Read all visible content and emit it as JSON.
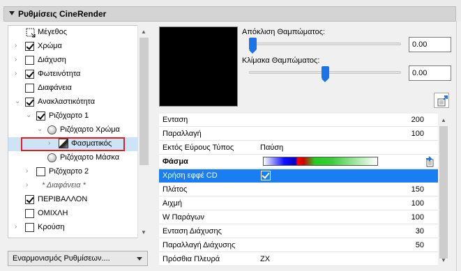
{
  "panel": {
    "title": "Ρυθμίσεις CineRender"
  },
  "tree": {
    "items": [
      {
        "label": "Μέγεθος",
        "indent": 0,
        "expander": false,
        "control": "size-icon",
        "checked": false,
        "italic": false
      },
      {
        "label": "Χρώμα",
        "indent": 0,
        "expander": true,
        "control": "checkbox",
        "checked": true,
        "italic": false
      },
      {
        "label": "Διάχυση",
        "indent": 0,
        "expander": true,
        "control": "checkbox",
        "checked": false,
        "italic": false
      },
      {
        "label": "Φωτεινότητα",
        "indent": 0,
        "expander": true,
        "control": "checkbox",
        "checked": true,
        "italic": false
      },
      {
        "label": "Διαφάνεια",
        "indent": 0,
        "expander": false,
        "control": "checkbox",
        "checked": false,
        "italic": false
      },
      {
        "label": "Ανακλαστικότητα",
        "indent": 0,
        "expander": true,
        "control": "checkbox",
        "checked": true,
        "italic": false,
        "expanded": true
      },
      {
        "label": "Ριζόχαρτο 1",
        "indent": 1,
        "expander": true,
        "control": "checkbox",
        "checked": true,
        "italic": false,
        "expanded": true
      },
      {
        "label": "Ριζόχαρτο Χρώμα",
        "indent": 2,
        "expander": true,
        "control": "radio",
        "checked": false,
        "italic": false,
        "expanded": true
      },
      {
        "label": "Φασματικός",
        "indent": 3,
        "expander": true,
        "control": "spectral-icon",
        "checked": false,
        "italic": false,
        "selected": true
      },
      {
        "label": "Ριζόχαρτο Μάσκα",
        "indent": 2,
        "expander": false,
        "control": "radio",
        "checked": false,
        "italic": false
      },
      {
        "label": "Ριζόχαρτο 2",
        "indent": 1,
        "expander": true,
        "control": "checkbox",
        "checked": false,
        "italic": false
      },
      {
        "label": "* Διαφάνεια *",
        "indent": 1,
        "expander": true,
        "control": "none",
        "checked": false,
        "italic": true
      },
      {
        "label": "ΠΕΡΙΒΑΛΛΟΝ",
        "indent": 0,
        "expander": false,
        "control": "checkbox",
        "checked": true,
        "italic": false
      },
      {
        "label": "ΟΜΙΧΛΗ",
        "indent": 0,
        "expander": false,
        "control": "checkbox",
        "checked": false,
        "italic": false
      },
      {
        "label": "Κρούση",
        "indent": 0,
        "expander": true,
        "control": "checkbox",
        "checked": false,
        "italic": false
      }
    ]
  },
  "dropdown": {
    "label": "Εναρμονισμός Ρυθμίσεων...."
  },
  "blur": {
    "deviation_label": "Απόκλιση Θαμπώματος:",
    "deviation_value": "0.00",
    "deviation_level": 0.0,
    "scale_label": "Κλίμακα Θαμπώματος:",
    "scale_value": "0.00",
    "scale_level": 0.5
  },
  "properties": {
    "rows": [
      {
        "name": "Ενταση",
        "value": "200",
        "type": "number"
      },
      {
        "name": "Παραλλαγή",
        "value": "100",
        "type": "number"
      },
      {
        "name": "Εκτός Εύρους Τύπος",
        "value": "Παύση",
        "type": "text"
      },
      {
        "name": "Φάσμα",
        "value": "",
        "type": "spectrum",
        "bold": true
      },
      {
        "name": "Χρήση εφφέ CD",
        "value": "",
        "type": "check",
        "checked": true,
        "highlight": true
      },
      {
        "name": "Πλάτος",
        "value": "150",
        "type": "number"
      },
      {
        "name": "Αιχμή",
        "value": "100",
        "type": "number"
      },
      {
        "name": "W Παράγων",
        "value": "100",
        "type": "number"
      },
      {
        "name": "Ενταση Διάχυσης",
        "value": "30",
        "type": "number"
      },
      {
        "name": "Παραλλαγή Διάχυσης",
        "value": "50",
        "type": "number"
      },
      {
        "name": "Πρόσθια Πλευρά",
        "value": "ZX",
        "type": "text"
      }
    ]
  },
  "colors": {
    "accent": "#1a7ef2",
    "selection_outline": "#e02020",
    "slider_thumb": "#1a73e8"
  }
}
